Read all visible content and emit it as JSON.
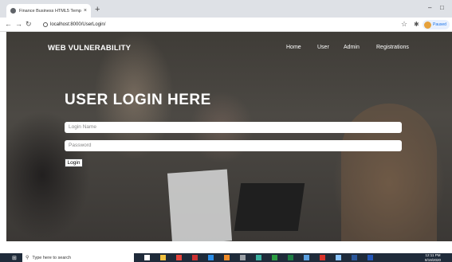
{
  "browser": {
    "tab_title": "Finance Business HTML5 Templ",
    "tab_close": "×",
    "new_tab": "+",
    "minimize": "–",
    "restore": "□",
    "url": "localhost:8000/UserLogin/",
    "profile_status": "Paused"
  },
  "site": {
    "brand": "WEB VULNERABILITY",
    "nav": [
      "Home",
      "User",
      "Admin",
      "Registrations"
    ],
    "hero_title": "USER LOGIN HERE",
    "login_name_placeholder": "Login Name",
    "password_placeholder": "Password",
    "login_button": "Login"
  },
  "taskbar": {
    "search_placeholder": "Type here to search",
    "time": "12:11 PM",
    "date": "8/19/2020",
    "icons": [
      "task-view",
      "file-explorer",
      "chrome",
      "red-app",
      "vs-code",
      "orange-app",
      "files",
      "gallery",
      "green-app",
      "excel",
      "photos",
      "pdf",
      "notepad",
      "word",
      "powershell"
    ],
    "icon_colors": [
      "#ffffff",
      "#f0c040",
      "#e8453c",
      "#cc3333",
      "#2c8ee8",
      "#f08c2a",
      "#9aa0a6",
      "#3ab0a0",
      "#2e9e44",
      "#1e7e45",
      "#5aa0e0",
      "#d9342b",
      "#8ac4ff",
      "#2b579a",
      "#2456b8"
    ]
  }
}
